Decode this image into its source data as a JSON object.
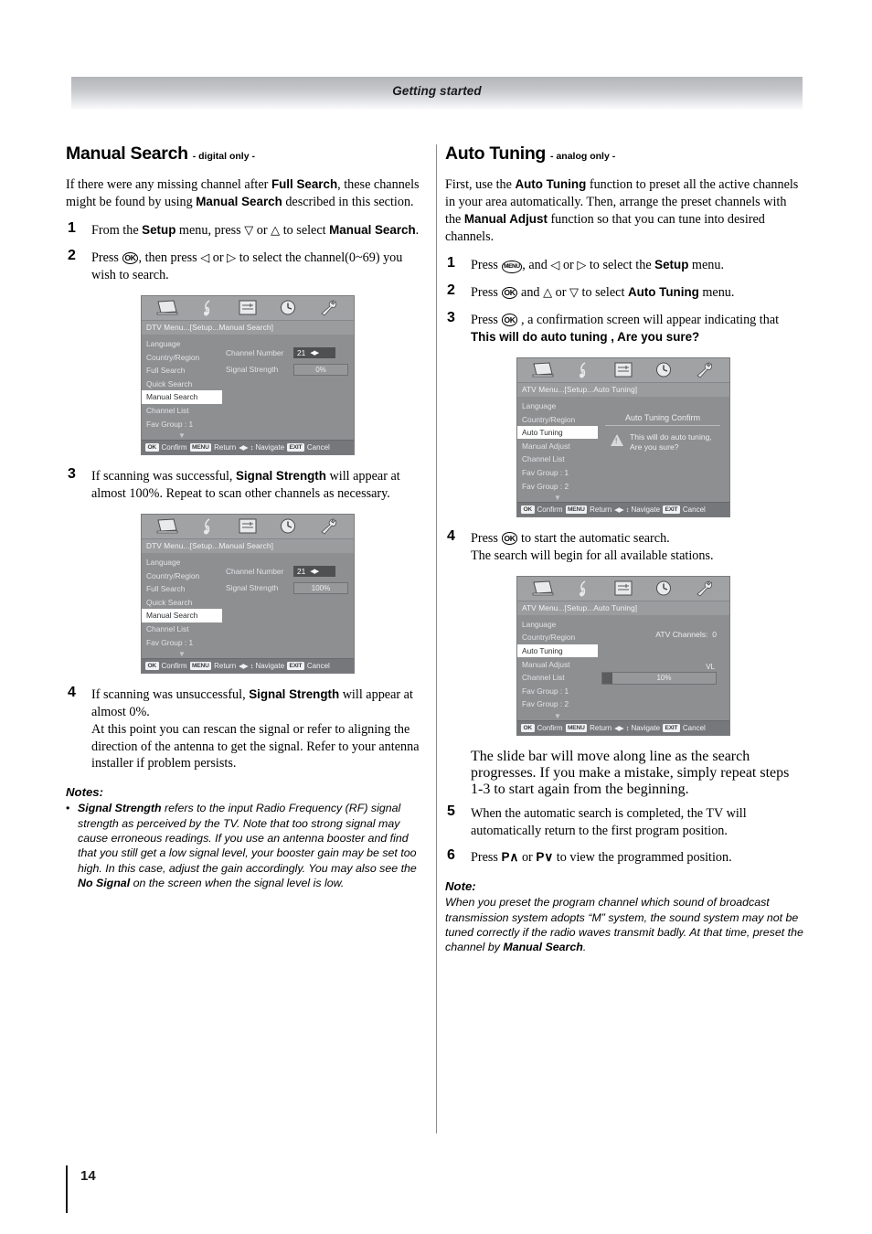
{
  "header": {
    "title": "Getting started"
  },
  "page": {
    "number": "14"
  },
  "left": {
    "title": "Manual Search",
    "title_sub": "- digital only -",
    "intro": [
      {
        "t": "If there were any missing channel after "
      },
      {
        "b": "Full Search"
      },
      {
        "t": ", these channels might be found by using "
      },
      {
        "b": "Manual Search"
      },
      {
        "t": " described in this section."
      }
    ],
    "steps": [
      {
        "num": "1",
        "text": "From the Setup menu, press ▽ or △ to select Manual Search."
      },
      {
        "num": "2",
        "text": "Press OK, then press ◁ or ▷ to select the channel(0~69) you wish to search."
      },
      {
        "num": "3",
        "text": "If scanning was successful, Signal Strength will appear at almost 100%. Repeat to scan other channels as necessary."
      },
      {
        "num": "4",
        "text": "If scanning was unsuccessful, Signal Strength will appear at almost 0%.",
        "cont": "At this point you can rescan the signal or refer to aligning the direction of the antenna to get the signal. Refer to your antenna installer if problem persists."
      }
    ],
    "notes_heading": "Notes:",
    "note_text": "Signal Strength refers to the input Radio Frequency (RF) signal strength as perceived by the TV. Note that too strong signal may cause erroneous readings. If you use an antenna booster and find that you still get a low signal level, your booster gain may be set too high. In this case, adjust the gain accordingly. You may also see the No Signal on the screen when the signal level is low.",
    "note_bold_1": "Signal Strength",
    "note_bold_2": "No Signal",
    "bullet": "•"
  },
  "right": {
    "title": "Auto Tuning",
    "title_sub": "- analog only -",
    "intro": [
      {
        "t": "First, use the "
      },
      {
        "b": "Auto Tuning"
      },
      {
        "t": " function to preset all the active channels in your area automatically. Then, arrange the preset channels with the "
      },
      {
        "b": "Manual Adjust"
      },
      {
        "t": " function so that you can tune into desired channels."
      }
    ],
    "steps": [
      {
        "num": "1",
        "text": "Press MENU, and ◁ or ▷ to select the Setup menu."
      },
      {
        "num": "2",
        "text": "Press OK and △ or ▽ to select Auto Tuning menu."
      },
      {
        "num": "3",
        "text": "Press OK , a confirmation screen will appear indicating that This will do auto tuning , Are you sure?"
      },
      {
        "num": "4",
        "text": "Press OK to start the automatic search.",
        "cont": "The search will begin for all available stations."
      },
      {
        "num": "5",
        "text": "When the automatic search is completed, the TV will automatically return to the first program position."
      },
      {
        "num": "6",
        "text": "Press P∧ or P∨ to view the programmed position."
      }
    ],
    "after_menu2": [
      "The slide bar will move along line as the search progresses.",
      "If you make a mistake, simply repeat steps 1-3 to start again from the beginning."
    ],
    "note_heading": "Note:",
    "note_text": "When you preset the program channel which sound of broadcast transmission system adopts “M” system, the sound system may not be tuned correctly if the radio waves transmit badly. At that time, preset the channel by Manual Search.",
    "note_bold": "Manual Search"
  },
  "osd_common": {
    "footer": {
      "ok": "OK",
      "ok_label": "Confirm",
      "menu": "MENU",
      "menu_label": "Return",
      "nav_glyph": "◀▶",
      "nav_updown": "↕",
      "nav_label": "Navigate",
      "exit": "EXIT",
      "exit_label": "Cancel"
    },
    "icons": [
      "screen-icon",
      "music-note-icon",
      "setup-list-icon",
      "clock-icon",
      "wrench-icon"
    ],
    "more_arrow": "▼"
  },
  "osd_dtv_1": {
    "path": "DTV Menu...[Setup...Manual Search]",
    "menu_items": [
      {
        "label": "Language",
        "selected": false
      },
      {
        "label": "Country/Region",
        "selected": false
      },
      {
        "label": "Full Search",
        "selected": false
      },
      {
        "label": "Quick Search",
        "selected": false
      },
      {
        "label": "Manual Search",
        "selected": true
      },
      {
        "label": "Channel List",
        "selected": false
      },
      {
        "label": "Fav Group : 1",
        "selected": false
      }
    ],
    "channel_label": "Channel Number",
    "channel_value": "21",
    "channel_arrows": "◀▶",
    "signal_label": "Signal Strength",
    "signal_value": "0%"
  },
  "osd_dtv_2": {
    "path": "DTV Menu...[Setup...Manual Search]",
    "menu_items": [
      {
        "label": "Language",
        "selected": false
      },
      {
        "label": "Country/Region",
        "selected": false
      },
      {
        "label": "Full Search",
        "selected": false
      },
      {
        "label": "Quick Search",
        "selected": false
      },
      {
        "label": "Manual Search",
        "selected": true
      },
      {
        "label": "Channel List",
        "selected": false
      },
      {
        "label": "Fav Group : 1",
        "selected": false
      }
    ],
    "channel_label": "Channel Number",
    "channel_value": "21",
    "channel_arrows": "◀▶",
    "signal_label": "Signal Strength",
    "signal_value": "100%"
  },
  "osd_atv_1": {
    "path": "ATV Menu...[Setup...Auto Tuning]",
    "menu_items": [
      {
        "label": "Language",
        "selected": false
      },
      {
        "label": "Country/Region",
        "selected": false
      },
      {
        "label": "Auto Tuning",
        "selected": true
      },
      {
        "label": "Manual Adjust",
        "selected": false
      },
      {
        "label": "Channel List",
        "selected": false
      },
      {
        "label": "Fav Group : 1",
        "selected": false
      },
      {
        "label": "Fav Group : 2",
        "selected": false
      }
    ],
    "confirm_title": "Auto Tuning Confirm",
    "confirm_line1": "This will do auto tuning,",
    "confirm_line2": "Are you sure?",
    "warn_glyph": "!"
  },
  "osd_atv_2": {
    "path": "ATV Menu...[Setup...Auto Tuning]",
    "menu_items": [
      {
        "label": "Language",
        "selected": false
      },
      {
        "label": "Country/Region",
        "selected": false
      },
      {
        "label": "Auto Tuning",
        "selected": true
      },
      {
        "label": "Manual Adjust",
        "selected": false
      },
      {
        "label": "Channel List",
        "selected": false
      },
      {
        "label": "Fav Group : 1",
        "selected": false
      },
      {
        "label": "Fav Group : 2",
        "selected": false
      }
    ],
    "channels_label": "ATV Channels:",
    "channels_value": "0",
    "vl_label": "VL",
    "progress_value": "10%",
    "progress_pct": 10
  }
}
